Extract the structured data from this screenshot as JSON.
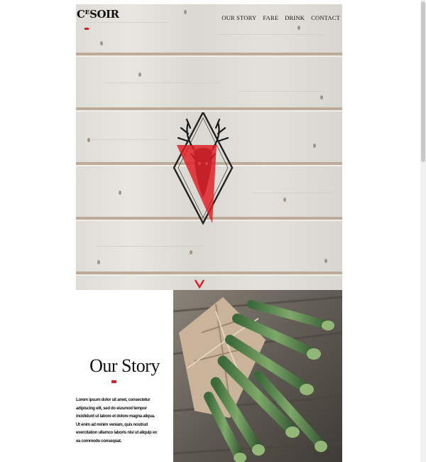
{
  "brand": {
    "logo_text": "CᴱSOIR"
  },
  "nav": {
    "items": [
      {
        "label": "OUR STORY"
      },
      {
        "label": "FARE"
      },
      {
        "label": "DRINK"
      },
      {
        "label": "CONTACT"
      }
    ]
  },
  "story": {
    "title": "Our Story",
    "body": "Lorem ipsum dolor sit amet, consectetur adipiscing elit, sed do eiusmod tempor incididunt ut labore et dolore magna aliqua. Ut enim ad minim veniam, quis nostrud exercitation ullamco laboris nisi ut aliquip ex ea commodo consequat."
  },
  "colors": {
    "accent": "#e11b22",
    "text": "#111111",
    "wood": "#dcdbd6"
  },
  "icons": {
    "emblem": "deer-head-diamond-emblem",
    "scroll": "chevron-down-icon"
  }
}
